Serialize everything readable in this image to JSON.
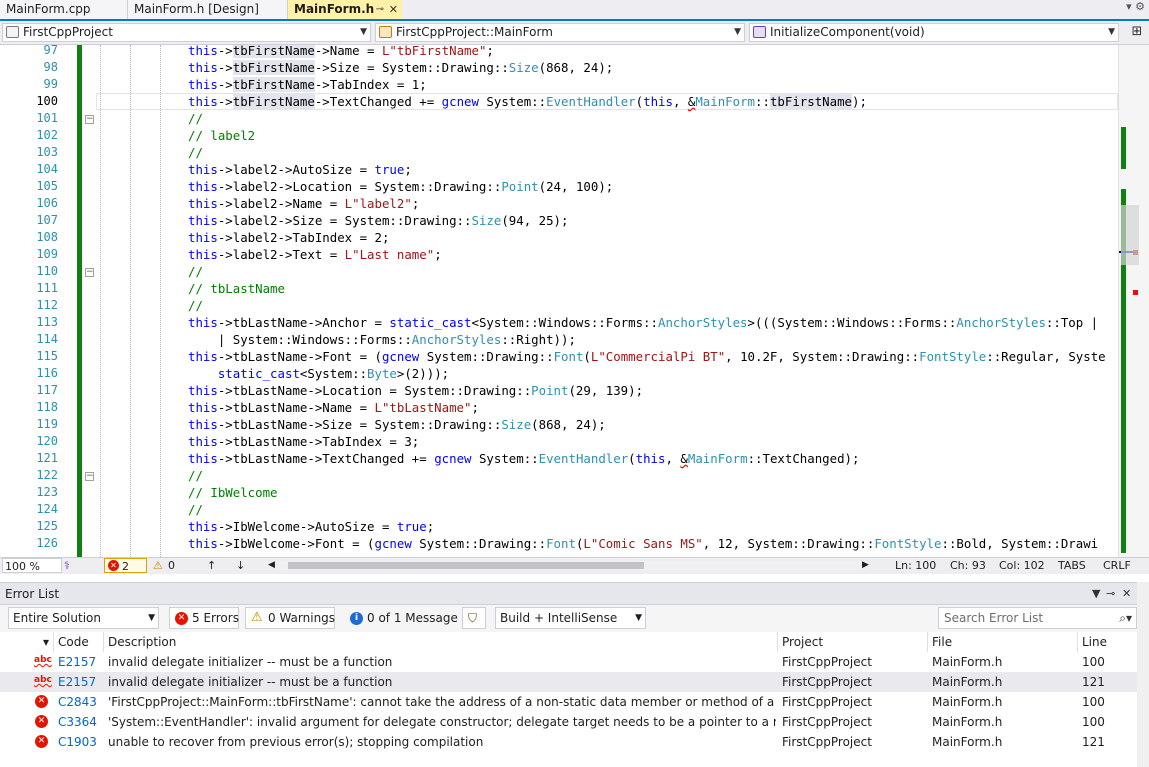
{
  "tabs": [
    {
      "label": "MainForm.cpp",
      "active": false
    },
    {
      "label": "MainForm.h [Design]",
      "active": false
    },
    {
      "label": "MainForm.h",
      "active": true
    }
  ],
  "tab_icons": {
    "pin": "pin-icon",
    "close": "close-icon"
  },
  "navbar": {
    "project": "FirstCppProject",
    "class": "FirstCppProject::MainForm",
    "member": "InitializeComponent(void)"
  },
  "editor": {
    "current_line": 100,
    "lines": [
      {
        "n": "97"
      },
      {
        "n": "98"
      },
      {
        "n": "99"
      },
      {
        "n": "100"
      },
      {
        "n": "101"
      },
      {
        "n": "102"
      },
      {
        "n": "103"
      },
      {
        "n": "104"
      },
      {
        "n": "105"
      },
      {
        "n": "106"
      },
      {
        "n": "107"
      },
      {
        "n": "108"
      },
      {
        "n": "109"
      },
      {
        "n": "110"
      },
      {
        "n": "111"
      },
      {
        "n": "112"
      },
      {
        "n": "113"
      },
      {
        "n": "114"
      },
      {
        "n": "115"
      },
      {
        "n": "116"
      },
      {
        "n": "117"
      },
      {
        "n": "118"
      },
      {
        "n": "119"
      },
      {
        "n": "120"
      },
      {
        "n": "121"
      },
      {
        "n": "122"
      },
      {
        "n": "123"
      },
      {
        "n": "124"
      },
      {
        "n": "125"
      },
      {
        "n": "126"
      }
    ]
  },
  "editor_status": {
    "zoom": "100 %",
    "errors": "2",
    "warnings": "0",
    "ln": "Ln: 100",
    "ch": "Ch: 93",
    "col": "Col: 102",
    "tabs": "TABS",
    "eol": "CRLF"
  },
  "error_list": {
    "title": "Error List",
    "scope": "Entire Solution",
    "errors_btn": "5 Errors",
    "warnings_btn": "0 Warnings",
    "messages_btn": "0 of 1 Message",
    "build_filter": "Build + IntelliSense",
    "search_placeholder": "Search Error List",
    "columns": {
      "code": "Code",
      "description": "Description",
      "project": "Project",
      "file": "File",
      "line": "Line"
    },
    "rows": [
      {
        "kind": "intellisense",
        "code": "E2157",
        "description": "invalid delegate initializer -- must be a function",
        "project": "FirstCppProject",
        "file": "MainForm.h",
        "line": "100"
      },
      {
        "kind": "intellisense",
        "code": "E2157",
        "description": "invalid delegate initializer -- must be a function",
        "project": "FirstCppProject",
        "file": "MainForm.h",
        "line": "121"
      },
      {
        "kind": "error",
        "code": "C2843",
        "description": "'FirstCppProject::MainForm::tbFirstName': cannot take the address of a non-static data member or method of a managed type",
        "project": "FirstCppProject",
        "file": "MainForm.h",
        "line": "100"
      },
      {
        "kind": "error",
        "code": "C3364",
        "description": "'System::EventHandler': invalid argument for delegate constructor; delegate target needs to be a pointer to a member function",
        "project": "FirstCppProject",
        "file": "MainForm.h",
        "line": "100"
      },
      {
        "kind": "error",
        "code": "C1903",
        "description": "unable to recover from previous error(s); stopping compilation",
        "project": "FirstCppProject",
        "file": "MainForm.h",
        "line": "121"
      }
    ]
  },
  "colors": {
    "accent": "#007acc",
    "active_tab": "#fff1a8",
    "error": "#e51400",
    "changebar": "#108010"
  }
}
